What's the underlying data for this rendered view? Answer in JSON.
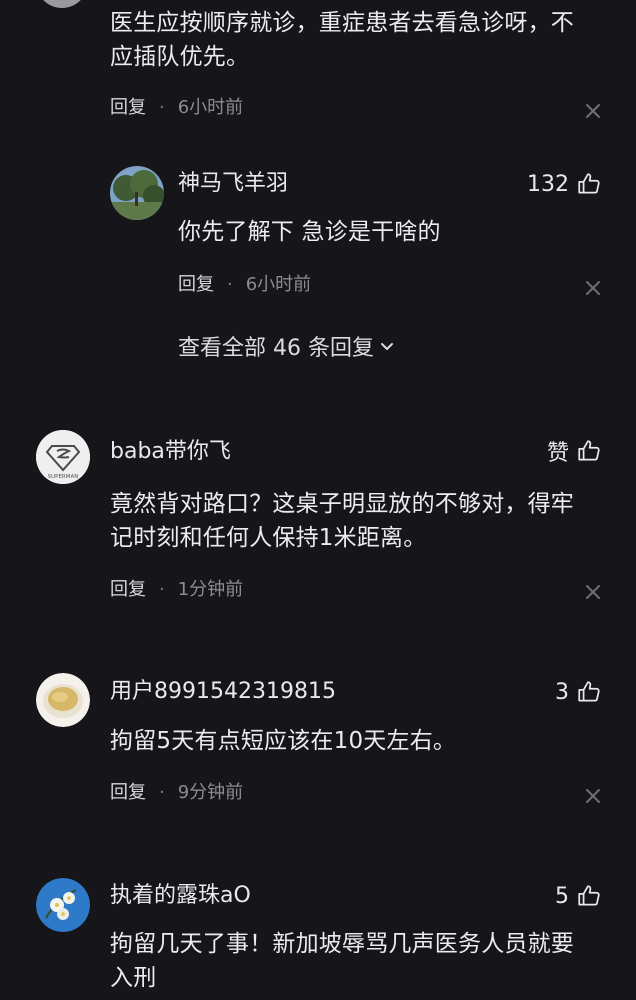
{
  "comments": [
    {
      "text_lines": [
        "医生应按顺序就诊，重症患者去看急诊呀，不",
        "应插队优先。"
      ],
      "reply_label": "回复",
      "separator": "·",
      "time": "6小时前",
      "sub_reply": {
        "username": "神马飞羊羽",
        "likes": "132",
        "text": "你先了解下 急诊是干啥的",
        "reply_label": "回复",
        "separator": "·",
        "time": "6小时前"
      },
      "view_all_replies": "查看全部 46 条回复"
    },
    {
      "username": "baba带你飞",
      "likes": "赞",
      "text_lines": [
        "竟然背对路口？这桌子明显放的不够对，得牢",
        "记时刻和任何人保持1米距离。"
      ],
      "reply_label": "回复",
      "separator": "·",
      "time": "1分钟前",
      "avatar_text": "SUPERMAN"
    },
    {
      "username": "用户8991542319815",
      "likes": "3",
      "text_lines": [
        "拘留5天有点短应该在10天左右。"
      ],
      "reply_label": "回复",
      "separator": "·",
      "time": "9分钟前"
    },
    {
      "username": "执着的露珠aO",
      "likes": "5",
      "text_lines": [
        "拘留几天了事！新加坡辱骂几声医务人员就要",
        "入刑"
      ]
    }
  ],
  "colors": {
    "background": "#16161a",
    "text": "#ececef",
    "muted": "#8b8b92"
  }
}
